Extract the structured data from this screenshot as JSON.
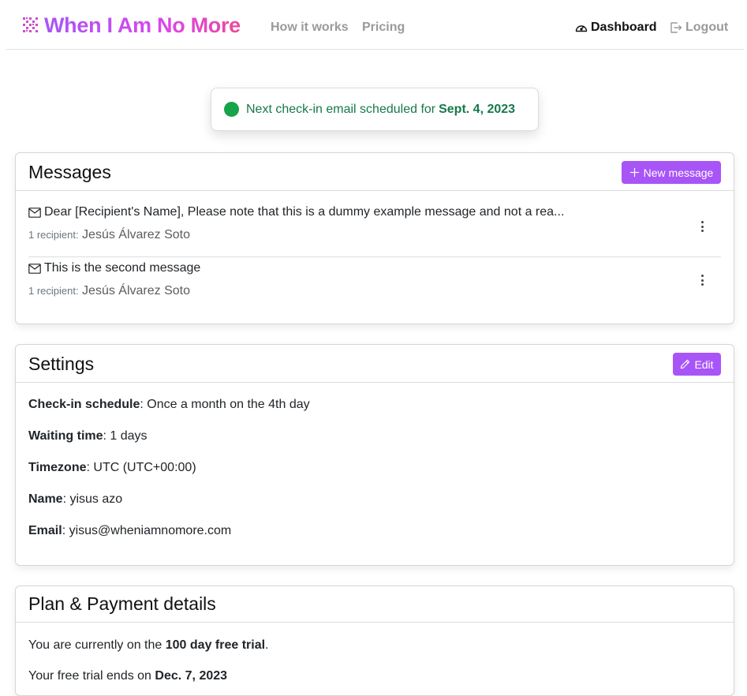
{
  "brand": {
    "name": "When I Am No More",
    "logo_icon": "dotted-grid-logo-icon"
  },
  "nav": {
    "links": [
      "How it works",
      "Pricing"
    ],
    "dashboard": "Dashboard",
    "logout": "Logout"
  },
  "status": {
    "text": "Next check-in email scheduled for",
    "date": "Sept. 4, 2023",
    "dot_color": "#16a34a"
  },
  "messages": {
    "title": "Messages",
    "new_button": "New message",
    "items": [
      {
        "subject": "Dear [Recipient's Name], Please note that this is a dummy example message and not a rea...",
        "recipients_label": "1 recipient:",
        "recipients": "Jesús Álvarez Soto"
      },
      {
        "subject": "This is the second message",
        "recipients_label": "1 recipient:",
        "recipients": "Jesús Álvarez Soto"
      }
    ]
  },
  "settings": {
    "title": "Settings",
    "edit_button": "Edit",
    "fields": [
      {
        "label": "Check-in schedule",
        "value": ": Once a month on the 4th day"
      },
      {
        "label": "Waiting time",
        "value": ": 1 days"
      },
      {
        "label": "Timezone",
        "value": ": UTC (UTC+00:00)"
      },
      {
        "label": "Name",
        "value": ": yisus azo"
      },
      {
        "label": "Email",
        "value": ": yisus@wheniamnomore.com"
      }
    ]
  },
  "plan": {
    "title": "Plan & Payment details",
    "line1_prefix": "You are currently on the",
    "line1_bold": "100 day free trial",
    "line1_suffix": ".",
    "line2_prefix": "Your free trial ends on",
    "line2_bold": "Dec. 7, 2023"
  },
  "colors": {
    "accent": "#a855f7",
    "brand_gradient_end": "#ec4899",
    "status_text": "#16794a"
  }
}
